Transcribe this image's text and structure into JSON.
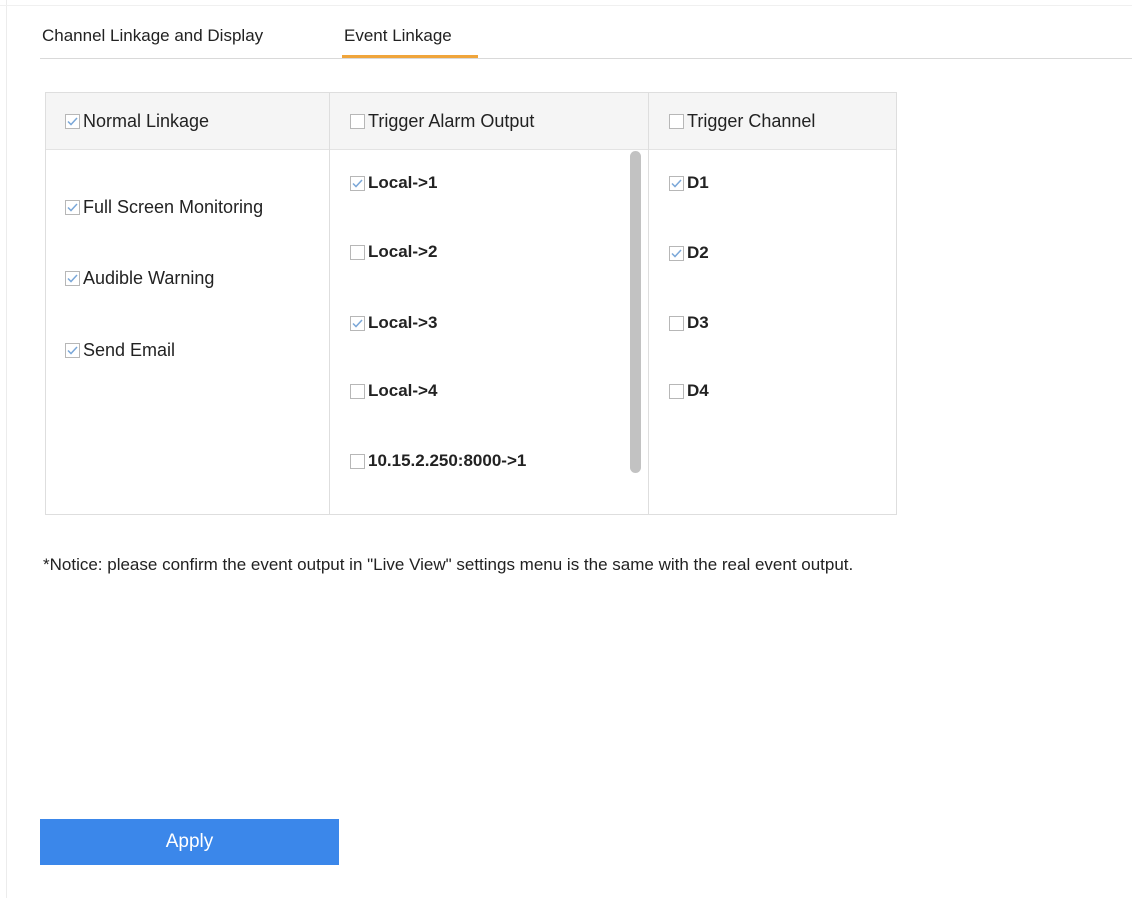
{
  "tabs": [
    {
      "label": "Channel Linkage and Display",
      "active": false
    },
    {
      "label": "Event Linkage",
      "active": true
    }
  ],
  "columns": {
    "normal": {
      "header": {
        "label": "Normal Linkage",
        "checked": true
      },
      "items": [
        {
          "label": "Full Screen Monitoring",
          "checked": true
        },
        {
          "label": "Audible Warning",
          "checked": true
        },
        {
          "label": "Send Email",
          "checked": true
        }
      ]
    },
    "alarm_output": {
      "header": {
        "label": "Trigger Alarm Output",
        "checked": false
      },
      "items": [
        {
          "label": "Local->1",
          "checked": true
        },
        {
          "label": "Local->2",
          "checked": false
        },
        {
          "label": "Local->3",
          "checked": true
        },
        {
          "label": "Local->4",
          "checked": false
        },
        {
          "label": "10.15.2.250:8000->1",
          "checked": false
        }
      ]
    },
    "channel": {
      "header": {
        "label": "Trigger Channel",
        "checked": false
      },
      "items": [
        {
          "label": "D1",
          "checked": true
        },
        {
          "label": "D2",
          "checked": true
        },
        {
          "label": "D3",
          "checked": false
        },
        {
          "label": "D4",
          "checked": false
        }
      ]
    }
  },
  "notice": "*Notice: please confirm the event output in \"Live View\" settings menu is the same with the real event output.",
  "apply_label": "Apply",
  "colors": {
    "accent": "#3b87ea",
    "tab_underline": "#f0a53b",
    "check": "#7aa7d8"
  }
}
